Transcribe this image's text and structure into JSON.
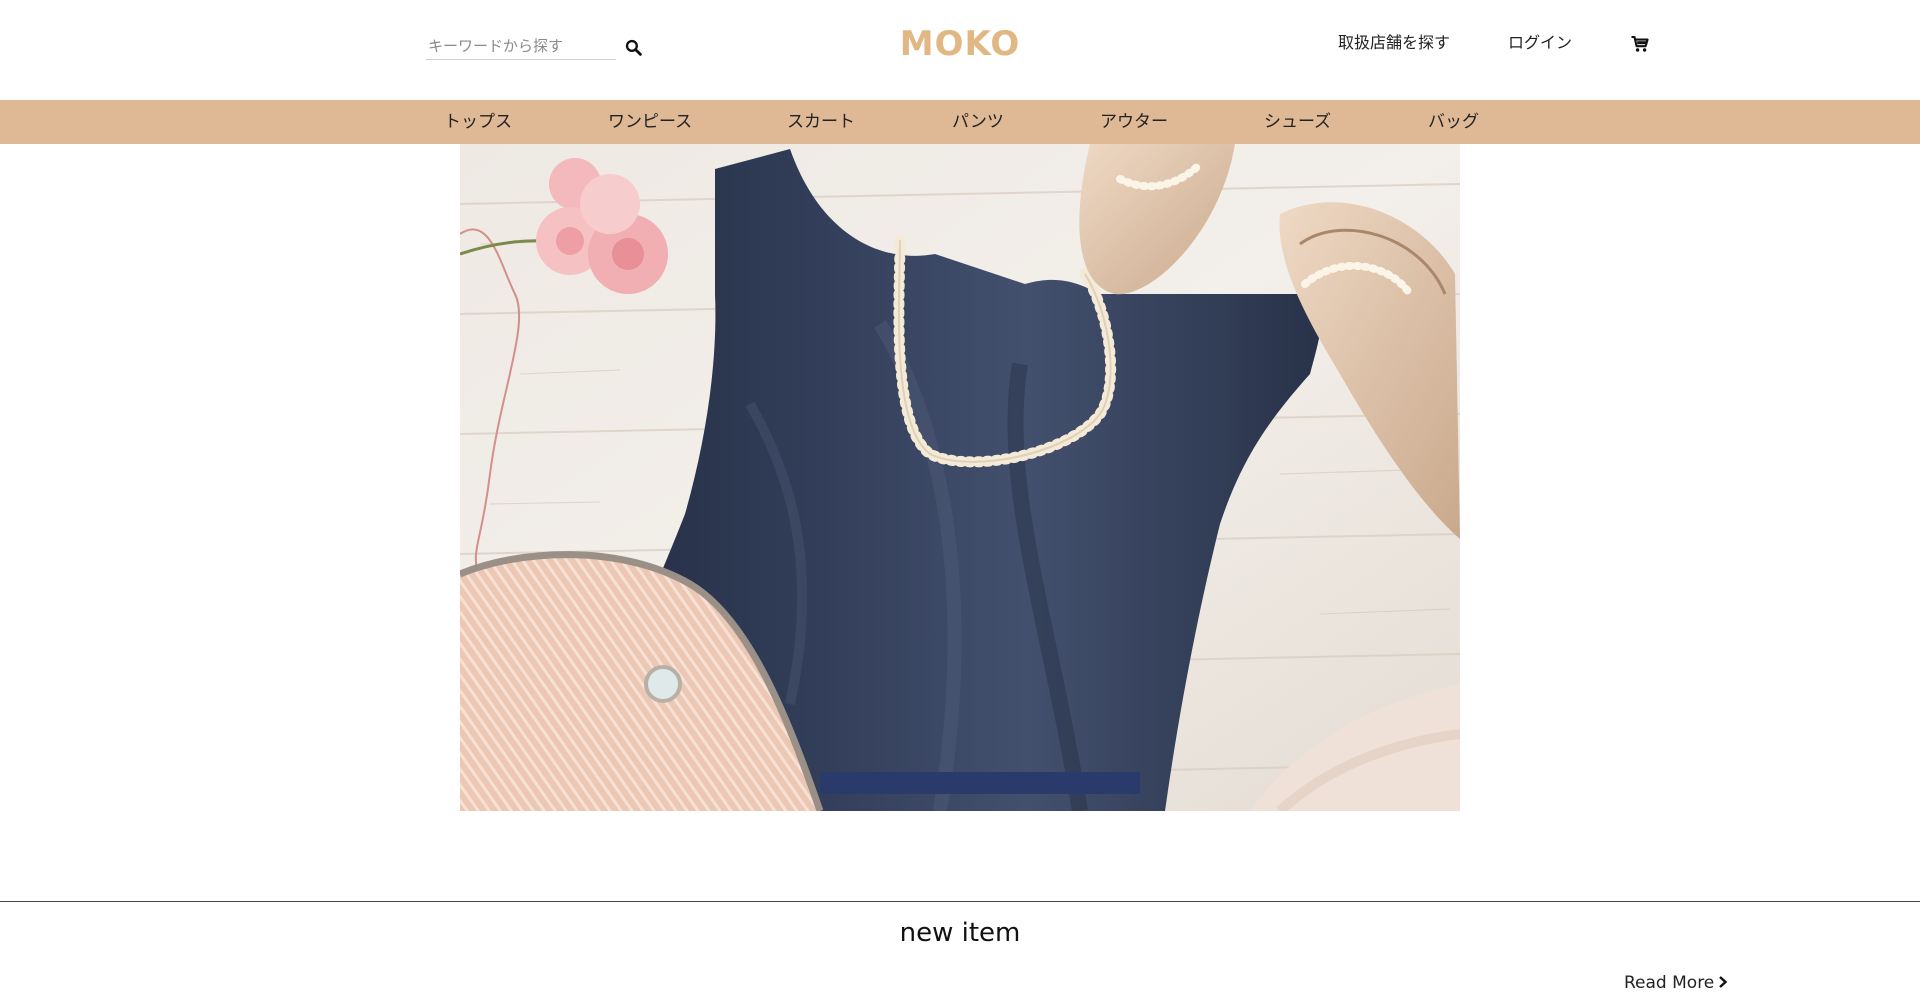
{
  "header": {
    "search": {
      "placeholder": "キーワードから探す",
      "value": "",
      "icon": "search-icon"
    },
    "logo": "MOKO",
    "store_link": "取扱店舗を探す",
    "login_link": "ログイン",
    "cart_icon": "cart-icon"
  },
  "colors": {
    "accent": "#dfb996",
    "logo": "#e1b884",
    "dress": "#2e3a55",
    "wood": "#ece6df"
  },
  "nav": {
    "items": [
      {
        "label": "トップス"
      },
      {
        "label": "ワンピース"
      },
      {
        "label": "スカート"
      },
      {
        "label": "パンツ"
      },
      {
        "label": "アウター"
      },
      {
        "label": "シューズ"
      },
      {
        "label": "バッグ"
      }
    ]
  },
  "hero": {
    "image": "navy-dress-with-pearl-necklace-pumps-and-clutch"
  },
  "new_items": {
    "title": "new item",
    "read_more": "Read More",
    "read_more_icon": "chevron-right-icon"
  }
}
